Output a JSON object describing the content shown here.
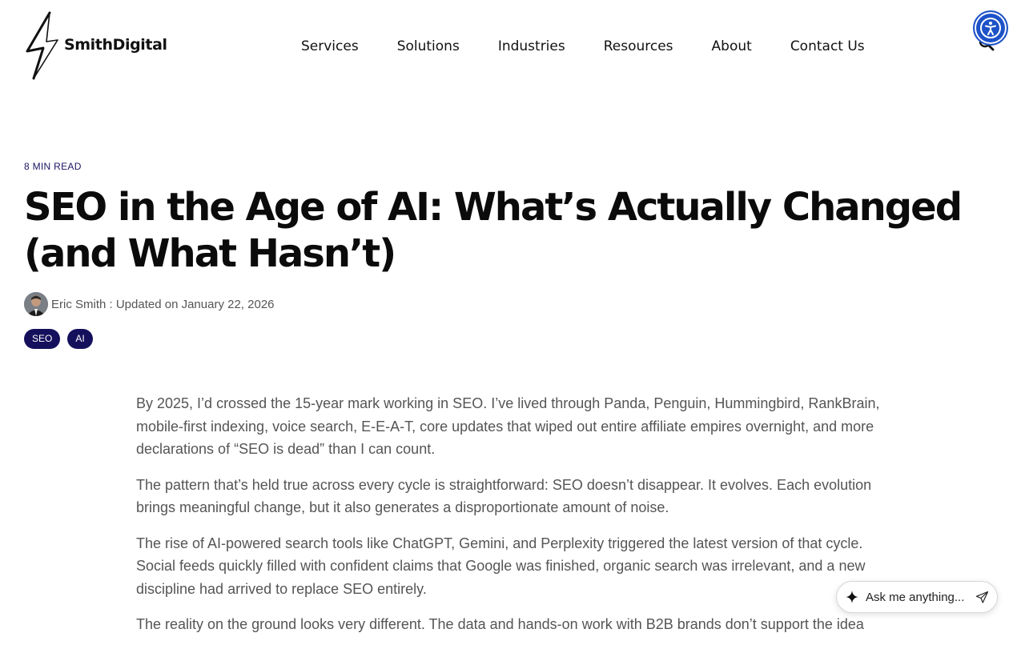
{
  "brand": {
    "name": "SmithDigital"
  },
  "nav": {
    "items": [
      {
        "label": "Services"
      },
      {
        "label": "Solutions"
      },
      {
        "label": "Industries"
      },
      {
        "label": "Resources"
      },
      {
        "label": "About"
      },
      {
        "label": "Contact Us"
      }
    ]
  },
  "icons": {
    "search": "search-icon",
    "accessibility": "accessibility-icon",
    "sparkle": "sparkle-icon",
    "send": "send-icon"
  },
  "article": {
    "read_time": "8 MIN READ",
    "title": "SEO in the Age of AI: What’s Actually Changed (and What Hasn’t)",
    "author": "Eric Smith",
    "updated": " : Updated on January 22, 2026",
    "tags": [
      "SEO",
      "AI"
    ],
    "paragraphs": [
      "By 2025, I’d crossed the 15-year mark working in SEO. I’ve lived through Panda, Penguin, Hummingbird, RankBrain, mobile-first indexing, voice search, E-E-A-T, core updates that wiped out entire affiliate empires overnight, and more declarations of “SEO is dead” than I can count.",
      "The pattern that’s held true across every cycle is straightforward: SEO doesn’t disappear. It evolves. Each evolution brings meaningful change, but it also generates a disproportionate amount of noise.",
      "The rise of AI-powered search tools like ChatGPT, Gemini, and Perplexity triggered the latest version of that cycle. Social feeds quickly filled with confident claims that Google was finished, organic search was irrelevant, and a new discipline had arrived to replace SEO entirely.",
      "The reality on the ground looks very different. The data and hands-on work with B2B brands don’t support the idea"
    ]
  },
  "assistant": {
    "placeholder": "Ask me anything..."
  },
  "colors": {
    "tag_bg": "#14105c",
    "accessibility_bg": "#1d52c8",
    "body_text": "#555555",
    "heading": "#0b0b0b"
  }
}
